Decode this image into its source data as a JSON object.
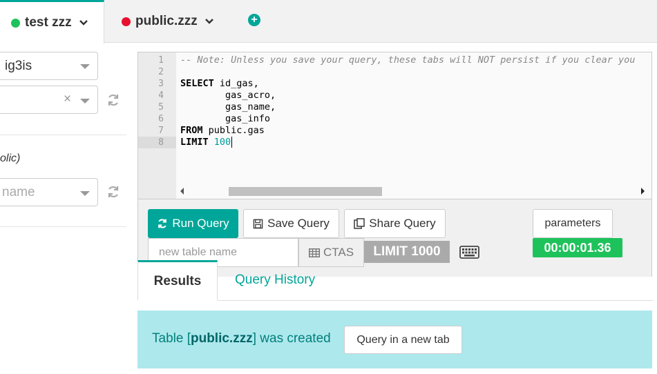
{
  "tabs": [
    {
      "label": "test zzz",
      "status_color": "#1ec25b",
      "active": true
    },
    {
      "label": "public.zzz",
      "status_color": "#e8102e",
      "active": false
    }
  ],
  "add_tab_icon": "plus-circle-icon",
  "left_panel": {
    "database_select_value": "ig3is",
    "schema_select_value": "",
    "schema_clear_glyph": "×",
    "schema_hint_text": "olic)",
    "table_select_placeholder": "name"
  },
  "editor": {
    "line_numbers": [
      "1",
      "2",
      "3",
      "4",
      "5",
      "6",
      "7",
      "8"
    ],
    "comment_line": "-- Note: Unless you save your query, these tabs will NOT persist if you clear you",
    "lines": {
      "l3_kw": "SELECT",
      "l3_rest": " id_gas,",
      "l4": "        gas_acro,",
      "l5": "        gas_name,",
      "l6": "        gas_info",
      "l7_kw": "FROM",
      "l7_rest": " public.gas",
      "l8_kw": "LIMIT",
      "l8_num": " 100"
    }
  },
  "toolbar": {
    "run_query_label": "Run Query",
    "save_query_label": "Save Query",
    "share_query_label": "Share Query",
    "parameters_label": "parameters",
    "new_table_placeholder": "new table name",
    "ctas_label": "CTAS",
    "limit_label": "LIMIT 1000",
    "timer": "00:00:01.36",
    "timer_color": "#1ec25b"
  },
  "result_tabs": {
    "results_label": "Results",
    "history_label": "Query History"
  },
  "alert": {
    "prefix": "Table [",
    "table_name": "public.zzz",
    "suffix": "] was created",
    "button_label": "Query in a new tab"
  },
  "colors": {
    "accent": "#00a699",
    "alert_bg": "#ade8ed"
  }
}
